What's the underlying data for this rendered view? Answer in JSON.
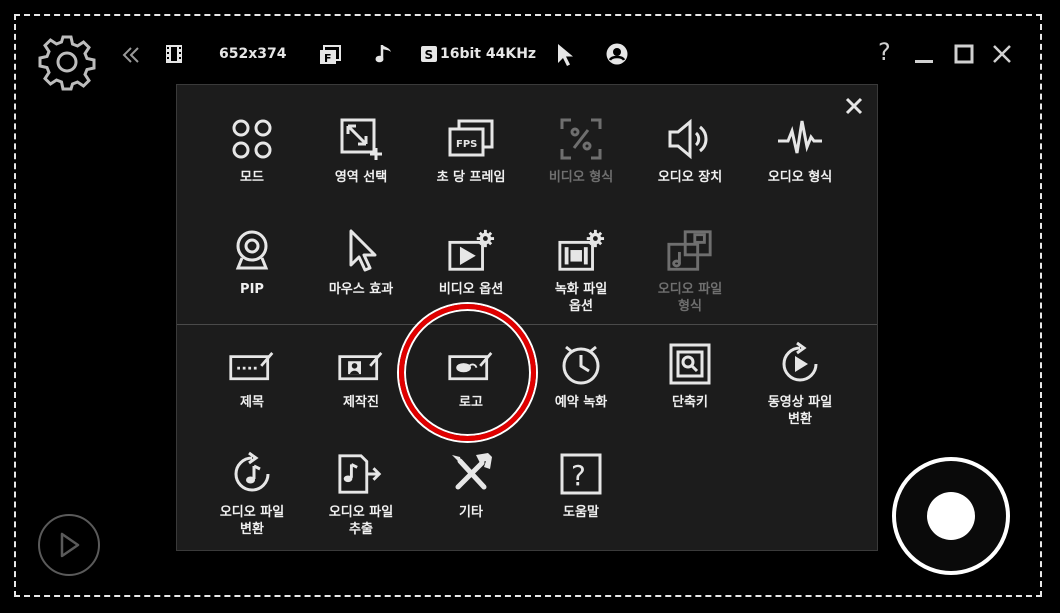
{
  "toolbar": {
    "resolution": "652x374",
    "audio_format": "16bit 44KHz",
    "help_label": "?"
  },
  "menu": {
    "row1": [
      {
        "name": "mode",
        "label": "모드",
        "icon": "grid-circles-icon",
        "disabled": false
      },
      {
        "name": "area-select",
        "label": "영역 선택",
        "icon": "area-select-icon",
        "disabled": false
      },
      {
        "name": "fps",
        "label": "초 당 프레임",
        "icon": "fps-icon",
        "disabled": false
      },
      {
        "name": "video-format",
        "label": "비디오 형식",
        "icon": "percent-icon",
        "disabled": true
      },
      {
        "name": "audio-device",
        "label": "오디오 장치",
        "icon": "speaker-icon",
        "disabled": false
      },
      {
        "name": "audio-format",
        "label": "오디오 형식",
        "icon": "waveform-icon",
        "disabled": false
      }
    ],
    "row2": [
      {
        "name": "pip",
        "label": "PIP",
        "icon": "webcam-icon",
        "disabled": false
      },
      {
        "name": "mouse-effect",
        "label": "마우스 효과",
        "icon": "cursor-icon",
        "disabled": false
      },
      {
        "name": "video-options",
        "label": "비디오 옵션",
        "icon": "video-gear-icon",
        "disabled": false
      },
      {
        "name": "record-file-options",
        "label": "녹화 파일\n옵션",
        "icon": "film-gear-icon",
        "disabled": false
      },
      {
        "name": "audio-file-format",
        "label": "오디오 파일\n형식",
        "icon": "audio-file-icon",
        "disabled": true
      }
    ],
    "row3": [
      {
        "name": "title",
        "label": "제목",
        "icon": "title-card-icon",
        "disabled": false
      },
      {
        "name": "credits",
        "label": "제작진",
        "icon": "credits-card-icon",
        "disabled": false
      },
      {
        "name": "logo",
        "label": "로고",
        "icon": "logo-card-icon",
        "disabled": false
      },
      {
        "name": "scheduled-recording",
        "label": "예약 녹화",
        "icon": "clock-icon",
        "disabled": false
      },
      {
        "name": "shortcuts",
        "label": "단축키",
        "icon": "key-icon",
        "disabled": false
      },
      {
        "name": "video-convert",
        "label": "동영상 파일\n변환",
        "icon": "video-convert-icon",
        "disabled": false
      }
    ],
    "row4": [
      {
        "name": "audio-convert",
        "label": "오디오 파일\n변환",
        "icon": "audio-convert-icon",
        "disabled": false
      },
      {
        "name": "audio-extract",
        "label": "오디오 파일\n추출",
        "icon": "audio-extract-icon",
        "disabled": false
      },
      {
        "name": "misc",
        "label": "기타",
        "icon": "tools-icon",
        "disabled": false
      },
      {
        "name": "help",
        "label": "도움말",
        "icon": "help-box-icon",
        "disabled": false
      }
    ]
  },
  "colors": {
    "highlight": "#e00000",
    "disabled": "#6f6f6f",
    "panel": "#1c1c1c"
  }
}
